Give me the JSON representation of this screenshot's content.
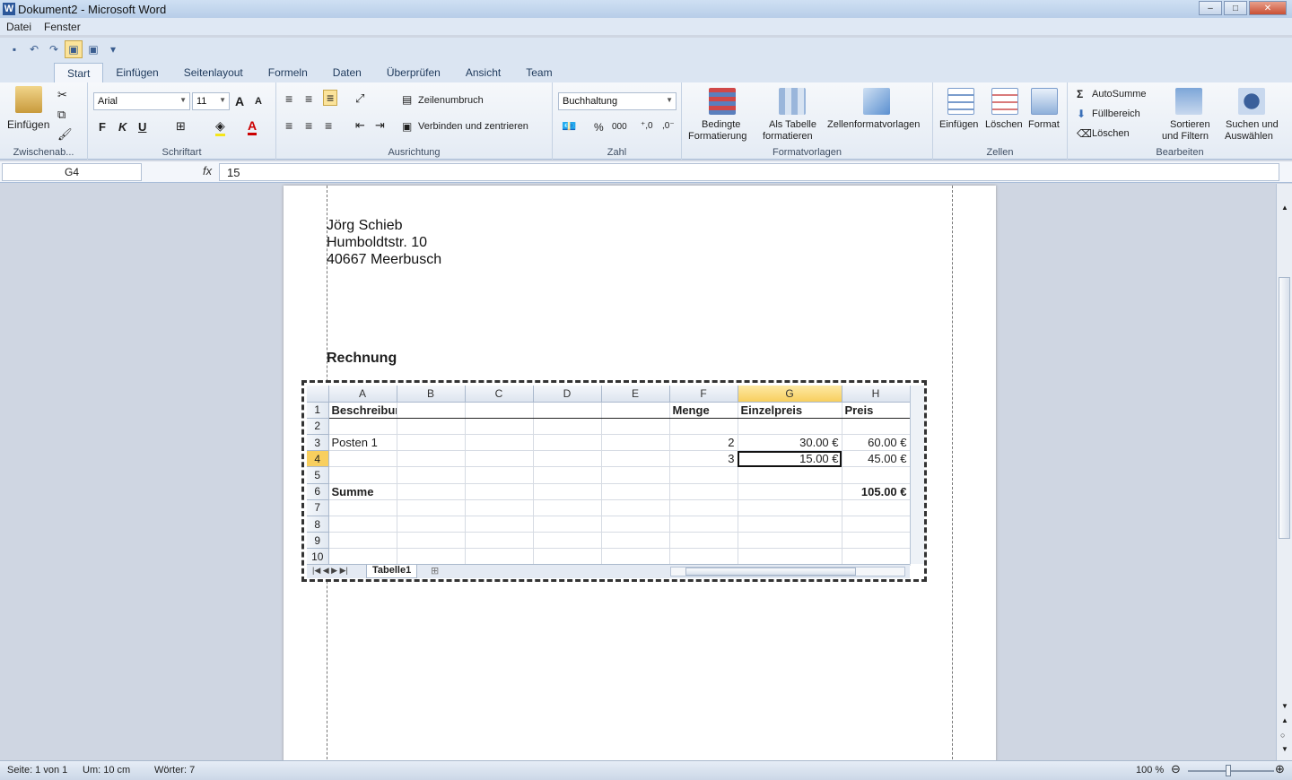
{
  "window": {
    "title": "Dokument2 - Microsoft Word",
    "app_icon": "W",
    "minimize": "–",
    "maximize": "□",
    "close": "✕"
  },
  "menu": [
    "Datei",
    "Fenster"
  ],
  "ribbon_tabs": [
    "Start",
    "Einfügen",
    "Seitenlayout",
    "Formeln",
    "Daten",
    "Überprüfen",
    "Ansicht",
    "Team"
  ],
  "ribbon": {
    "clipboard": {
      "paste": "Einfügen",
      "label": "Zwischenab..."
    },
    "font": {
      "name": "Arial",
      "size": "11",
      "bold": "F",
      "italic": "K",
      "underline": "U",
      "grow": "A",
      "shrink": "A",
      "label": "Schriftart"
    },
    "alignment": {
      "wrap": "Zeilenumbruch",
      "merge": "Verbinden und zentrieren",
      "label": "Ausrichtung"
    },
    "number": {
      "format": "Buchhaltung",
      "percent": "%",
      "thousands": "000",
      "label": "Zahl"
    },
    "styles": {
      "conditional1": "Bedingte",
      "conditional2": "Formatierung",
      "table1": "Als Tabelle",
      "table2": "formatieren",
      "cellstyles": "Zellenformatvorlagen",
      "label": "Formatvorlagen"
    },
    "cells": {
      "insert": "Einfügen",
      "delete": "Löschen",
      "format": "Format",
      "label": "Zellen"
    },
    "editing": {
      "autosum": "AutoSumme",
      "fill": "Füllbereich",
      "clear": "Löschen",
      "sort1": "Sortieren",
      "sort2": "und Filtern",
      "find1": "Suchen und",
      "find2": "Auswählen",
      "label": "Bearbeiten"
    }
  },
  "formula_bar": {
    "name_box": "G4",
    "fx": "fx",
    "value": "15"
  },
  "document": {
    "address": [
      "Jörg Schieb",
      "Humboldtstr. 10",
      "40667 Meerbusch"
    ],
    "heading": "Rechnung"
  },
  "spreadsheet": {
    "columns": [
      "A",
      "B",
      "C",
      "D",
      "E",
      "F",
      "G",
      "H"
    ],
    "selected_column": "G",
    "selected_row": "4",
    "rows": [
      {
        "n": "1",
        "cells": [
          "Beschreibung",
          "",
          "",
          "",
          "",
          "Menge",
          "Einzelpreis",
          "Preis"
        ]
      },
      {
        "n": "2",
        "cells": [
          "",
          "",
          "",
          "",
          "",
          "",
          "",
          ""
        ]
      },
      {
        "n": "3",
        "cells": [
          "Posten 1",
          "",
          "",
          "",
          "",
          "2",
          "30.00 €",
          "60.00 €"
        ]
      },
      {
        "n": "4",
        "cells": [
          "",
          "",
          "",
          "",
          "",
          "3",
          "15.00 €",
          "45.00 €"
        ]
      },
      {
        "n": "5",
        "cells": [
          "",
          "",
          "",
          "",
          "",
          "",
          "",
          ""
        ]
      },
      {
        "n": "6",
        "cells": [
          "Summe",
          "",
          "",
          "",
          "",
          "",
          "",
          "105.00 €"
        ]
      },
      {
        "n": "7",
        "cells": [
          "",
          "",
          "",
          "",
          "",
          "",
          "",
          ""
        ]
      },
      {
        "n": "8",
        "cells": [
          "",
          "",
          "",
          "",
          "",
          "",
          "",
          ""
        ]
      },
      {
        "n": "9",
        "cells": [
          "",
          "",
          "",
          "",
          "",
          "",
          "",
          ""
        ]
      },
      {
        "n": "10",
        "cells": [
          "",
          "",
          "",
          "",
          "",
          "",
          "",
          ""
        ]
      }
    ],
    "sheet_tab": "Tabelle1"
  },
  "status": {
    "page": "Seite: 1 von 1",
    "position": "Um: 10 cm",
    "words": "Wörter: 7",
    "zoom": "100 %"
  },
  "colors": {
    "accent": "#f8cf5e",
    "ribbon_bg": "#e4ebf4",
    "title_bg": "#b7cde8"
  }
}
